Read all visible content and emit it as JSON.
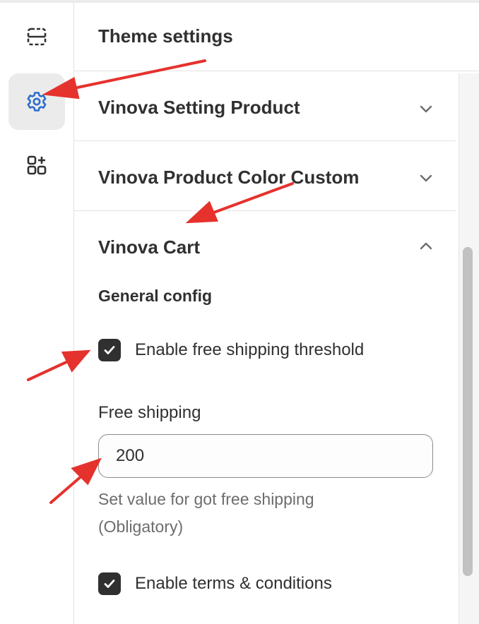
{
  "panel": {
    "title": "Theme settings"
  },
  "rail": {
    "items": [
      {
        "icon": "sections-icon",
        "active": false
      },
      {
        "icon": "gear-icon",
        "active": true
      },
      {
        "icon": "apps-add-icon",
        "active": false
      }
    ]
  },
  "sections": [
    {
      "title": "Vinova Setting Product",
      "expanded": false
    },
    {
      "title": "Vinova Product Color Custom",
      "expanded": false
    },
    {
      "title": "Vinova Cart",
      "expanded": true
    }
  ],
  "cart": {
    "group_title": "General config",
    "enable_free_shipping": {
      "label": "Enable free shipping threshold",
      "checked": true
    },
    "free_shipping": {
      "label": "Free shipping",
      "value": "200",
      "help": "Set value for got free shipping (Obligatory)"
    },
    "enable_terms": {
      "label": "Enable terms & conditions",
      "checked": true
    }
  },
  "colors": {
    "accent": "#2c6ecb",
    "annotation": "#e5322d",
    "checkbox": "#303030"
  }
}
